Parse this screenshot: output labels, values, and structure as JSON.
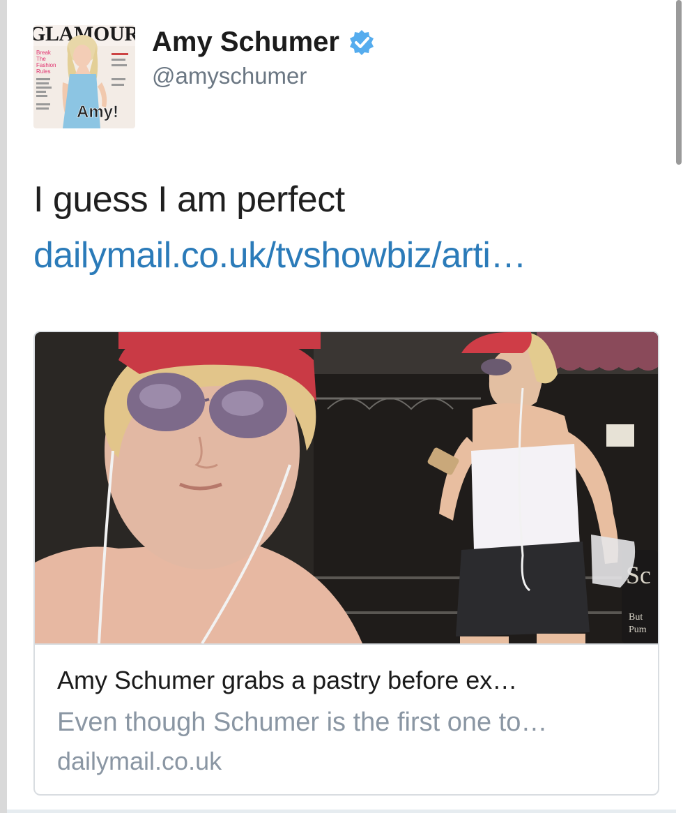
{
  "tweet": {
    "display_name": "Amy Schumer",
    "handle": "@amyschumer",
    "verified": true,
    "text": "I guess I am perfect",
    "link_text": "dailymail.co.uk/tvshowbiz/arti…",
    "avatar": {
      "magazine_masthead": "GLAMOUR",
      "cover_text_left": "Break The Fashion Rules",
      "cover_name": "Amy!"
    }
  },
  "card": {
    "title": "Amy Schumer grabs a pastry before ex…",
    "description": "Even though Schumer is the first one to…",
    "domain": "dailymail.co.uk"
  },
  "colors": {
    "link": "#2b7bb9",
    "verified_badge": "#55acee",
    "secondary_text": "#8a96a3",
    "handle_text": "#6b7783"
  },
  "icons": {
    "verified": "verified-badge-icon"
  }
}
